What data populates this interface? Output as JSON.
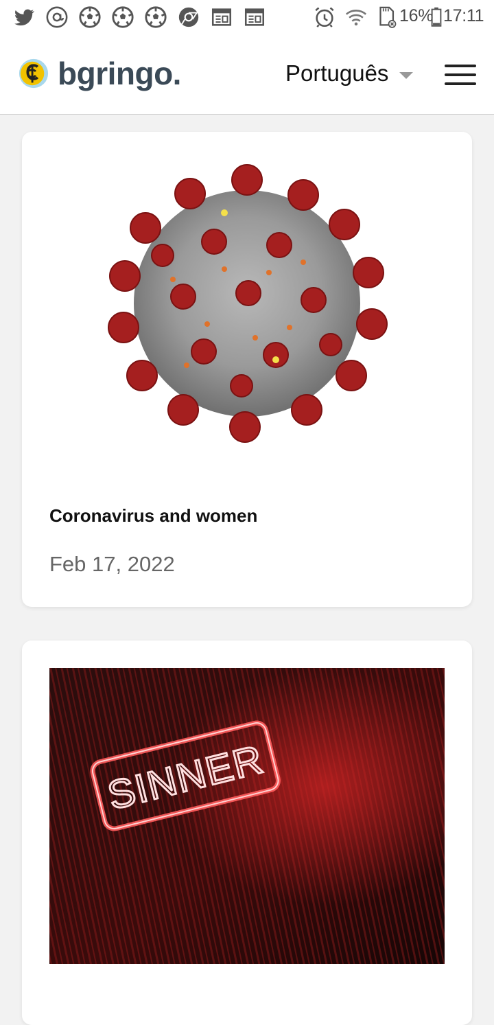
{
  "status_bar": {
    "battery": "16%",
    "time": "17:11",
    "icons": [
      "twitter-icon",
      "at-icon",
      "soccer-ball-icon",
      "soccer-ball-icon",
      "soccer-ball-icon",
      "chrome-icon",
      "news-icon",
      "news-icon",
      "alarm-icon",
      "wifi-icon",
      "sd-card-icon",
      "battery-icon"
    ]
  },
  "header": {
    "brand": "bgringo.",
    "language": "Português"
  },
  "posts": [
    {
      "title": "Coronavirus and women",
      "date": "Feb 17, 2022",
      "image": "coronavirus-illustration"
    },
    {
      "title": "",
      "date": "",
      "image": "neon-sign",
      "image_text": "SINNER"
    }
  ],
  "colors": {
    "brand_text": "#3b4a57",
    "logo_yellow": "#f2c200",
    "page_bg": "#f2f2f2",
    "card_bg": "#ffffff"
  }
}
